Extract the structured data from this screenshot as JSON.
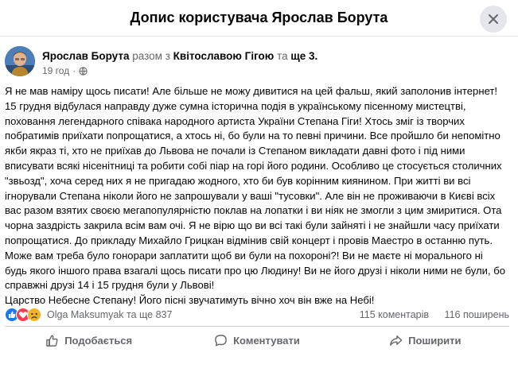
{
  "header": {
    "title": "Допис користувача Ярослав Борута"
  },
  "post": {
    "author": "Ярослав Борута",
    "with_prefix": "разом з",
    "tagged": "Квітославою Гігою",
    "and": "та",
    "others": "ще 3.",
    "time": "19 год",
    "paragraphs": [
      "Я не мав наміру щось писати! Але більше не можу дивитися на цей фальш, який заполонив інтернет! 15 грудня відбулася направду дуже сумна історична подія в українському пісенному мистецтві, поховання легендарного співака народного артиста України Степана Гіги! Хтось зміг із творчих побратимів приїхати попрощатися, а хтось ні, бо були на то певні причини. Все пройшло би непомітно якби якраз ті, хто не приїхав до Львова не почали із Степаном викладати давні фото і під ними вписувати всякі нісенітниці та робити собі піар на горі його родини. Особливо це стосується столичних \"звьозд\", хоча серед них я не пригадаю жодного, хто би був корінним киянином. При житті ви всі ігнорували Степана ніколи його не запрошували у ваші \"тусовки\". Але він не проживаючи в Києві всіх вас разом взятих своєю мегапопулярністю поклав на лопатки і ви ніяк не змогли з цим змиритися. Ота чорна заздрість закрила всім вам очі. Я не вірю що ви всі такі були зайняті і не знайшли часу приїхати попрощатися. До прикладу Михайло Грицкан відмінив свій концерт і провів Маестро в останню путь. Може вам треба було гонорари заплатити щоб ви були на похороні?! Ви не маєте ні морального ні будь якого іншого права взагалі щось писати про цю Людину! Ви не його друзі і ніколи ними не були, бо справжні друзі 14 і 15 грудня були у Львові!",
      "Царство Небесне Степану! Його пісні звучатимуть вічно хоч він вже на Небі!"
    ]
  },
  "reactions": {
    "names": "Olga Maksumyak та ще 837",
    "comments": "115 коментарів",
    "shares": "116 поширень"
  },
  "actions": {
    "like": "Подобається",
    "comment": "Коментувати",
    "share": "Поширити"
  },
  "icons": {
    "close": "close-icon",
    "globe": "globe-icon",
    "more": "more-icon",
    "like_reaction": "like-reaction-icon",
    "love_reaction": "love-reaction-icon",
    "sad_reaction": "sad-reaction-icon",
    "like": "thumbs-up-icon",
    "comment": "comment-icon",
    "share": "share-icon"
  },
  "colors": {
    "like_blue": "#1877f2",
    "love_red": "#f33e58",
    "sad_yellow": "#f7b125",
    "secondary_text": "#65676b"
  }
}
